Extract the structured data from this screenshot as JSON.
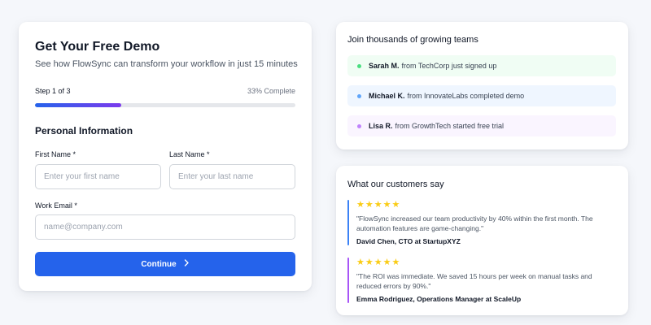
{
  "form": {
    "title": "Get Your Free Demo",
    "subtitle": "See how FlowSync can transform your workflow in just 15 minutes",
    "step_label": "Step 1 of 3",
    "step_percent": "33% Complete",
    "progress": 0.33,
    "section_title": "Personal Information",
    "first_name_label": "First Name *",
    "first_name_placeholder": "Enter your first name",
    "last_name_label": "Last Name *",
    "last_name_placeholder": "Enter your last name",
    "email_label": "Work Email *",
    "email_placeholder": "name@company.com",
    "continue_label": "Continue",
    "continue_icon": "chevron-right-icon"
  },
  "teams": {
    "title": "Join thousands of growing teams",
    "items": [
      {
        "name": "Sarah M.",
        "text": "from TechCorp just signed up",
        "dot_color": "#4ade80",
        "bg_color": "#f0fdf4"
      },
      {
        "name": "Michael K.",
        "text": "from InnovateLabs completed demo",
        "dot_color": "#60a5fa",
        "bg_color": "#eff6ff"
      },
      {
        "name": "Lisa R.",
        "text": "from GrowthTech started free trial",
        "dot_color": "#c084fc",
        "bg_color": "#faf5ff"
      }
    ]
  },
  "reviews": {
    "title": "What our customers say",
    "items": [
      {
        "stars": "★★★★★",
        "rating": 5,
        "quote": "\"FlowSync increased our team productivity by 40% within the first month. The automation features are game-changing.\"",
        "author": "David Chen, CTO at StartupXYZ",
        "bar_color": "#3b82f6"
      },
      {
        "stars": "★★★★★",
        "rating": 5,
        "quote": "\"The ROI was immediate. We saved 15 hours per week on manual tasks and reduced errors by 90%.\"",
        "author": "Emma Rodriguez, Operations Manager at ScaleUp",
        "bar_color": "#a855f7"
      }
    ]
  },
  "colors": {
    "accent": "#2563eb",
    "accent_secondary": "#7c3aed",
    "background": "#f5f7fb",
    "star": "#facc15"
  }
}
